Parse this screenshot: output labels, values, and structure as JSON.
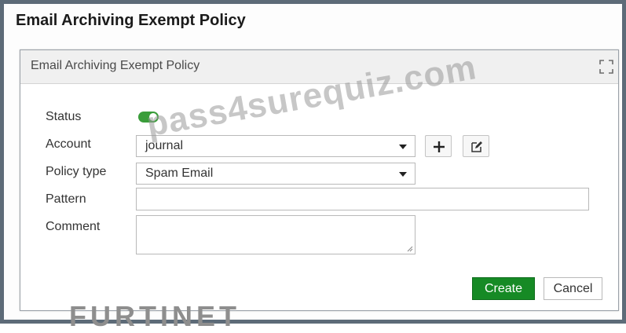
{
  "page": {
    "title": "Email Archiving Exempt Policy"
  },
  "dialog": {
    "title": "Email Archiving Exempt Policy",
    "expand_icon": "expand-icon"
  },
  "form": {
    "status": {
      "label": "Status",
      "enabled": true,
      "accent": "#3a9d3a"
    },
    "account": {
      "label": "Account",
      "value": "journal",
      "add_icon": "plus-icon",
      "edit_icon": "edit-icon"
    },
    "policy_type": {
      "label": "Policy type",
      "value": "Spam Email"
    },
    "pattern": {
      "label": "Pattern",
      "value": ""
    },
    "comment": {
      "label": "Comment",
      "value": ""
    }
  },
  "actions": {
    "create_label": "Create",
    "cancel_label": "Cancel",
    "create_color": "#168a25"
  },
  "watermark": "pass4surequiz.com",
  "logo": "FURTINET"
}
